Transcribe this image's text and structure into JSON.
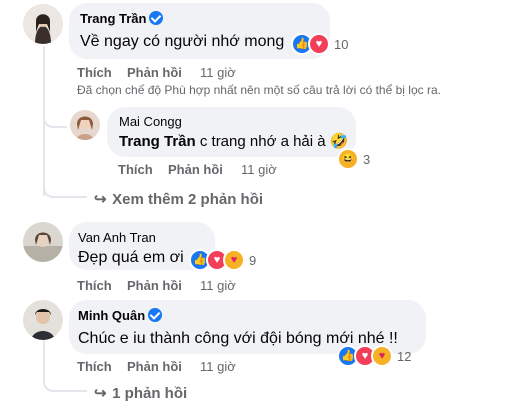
{
  "comments": [
    {
      "author": "Trang Trần",
      "verified": true,
      "text": "Về ngay có người nhớ mong",
      "reactions": [
        "like",
        "love"
      ],
      "reaction_count": "10",
      "actions": {
        "like": "Thích",
        "reply": "Phản hồi",
        "time": "11 giờ"
      },
      "filter_note": "Đã chọn chế độ Phù hợp nhất nên một số câu trả lời có thể bị lọc ra.",
      "replies": [
        {
          "author": "Mai Congg",
          "mention": "Trang Trần",
          "text": " c trang nhớ a hải à 🤣",
          "reactions": [
            "haha"
          ],
          "reaction_count": "3",
          "actions": {
            "like": "Thích",
            "reply": "Phản hồi",
            "time": "11 giờ"
          }
        }
      ],
      "more_replies": "Xem thêm 2 phản hồi"
    },
    {
      "author": "Van Anh Tran",
      "verified": false,
      "text": "Đẹp quá em ơi",
      "reactions": [
        "like",
        "love",
        "care"
      ],
      "reaction_count": "9",
      "actions": {
        "like": "Thích",
        "reply": "Phản hồi",
        "time": "11 giờ"
      }
    },
    {
      "author": "Minh Quân",
      "verified": true,
      "text": "Chúc e iu thành công với đội bóng mới nhé !!",
      "reactions": [
        "like",
        "love",
        "care"
      ],
      "reaction_count": "12",
      "actions": {
        "like": "Thích",
        "reply": "Phản hồi",
        "time": "11 giờ"
      },
      "more_replies": "1 phản hồi"
    }
  ]
}
